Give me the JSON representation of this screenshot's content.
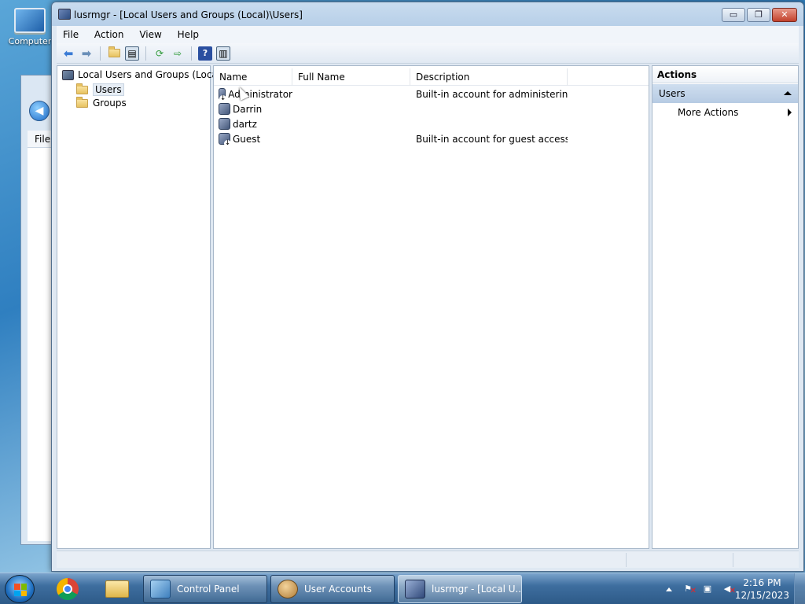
{
  "desktop": {
    "icon_label": "Computer"
  },
  "background_window": {
    "menu_label": "File"
  },
  "window": {
    "title": "lusrmgr - [Local Users and Groups (Local)\\Users]",
    "buttons": {
      "minimize": "▭",
      "maximize": "❐",
      "close": "✕"
    }
  },
  "menubar": {
    "items": [
      "File",
      "Action",
      "View",
      "Help"
    ]
  },
  "toolbar": {
    "icons": [
      "back-arrow-icon",
      "forward-arrow-icon",
      "up-folder-icon",
      "show-hide-tree-icon",
      "refresh-icon",
      "export-list-icon",
      "help-icon",
      "show-hide-action-pane-icon"
    ]
  },
  "tree": {
    "root": "Local Users and Groups (Local)",
    "items": [
      "Users",
      "Groups"
    ],
    "selected": "Users"
  },
  "list": {
    "columns": {
      "name": "Name",
      "full_name": "Full Name",
      "description": "Description"
    },
    "rows": [
      {
        "name": "Administrator",
        "full_name": "",
        "description": "Built-in account for administering..."
      },
      {
        "name": "Darrin",
        "full_name": "",
        "description": ""
      },
      {
        "name": "dartz",
        "full_name": "",
        "description": ""
      },
      {
        "name": "Guest",
        "full_name": "",
        "description": "Built-in account for guest access t..."
      }
    ]
  },
  "actions": {
    "title": "Actions",
    "section": "Users",
    "items": [
      "More Actions"
    ]
  },
  "taskbar": {
    "tasks": [
      "Control Panel",
      "User Accounts",
      "lusrmgr - [Local U..."
    ],
    "active_task": "lusrmgr - [Local U...",
    "clock": {
      "time": "2:16 PM",
      "date": "12/15/2023"
    }
  }
}
